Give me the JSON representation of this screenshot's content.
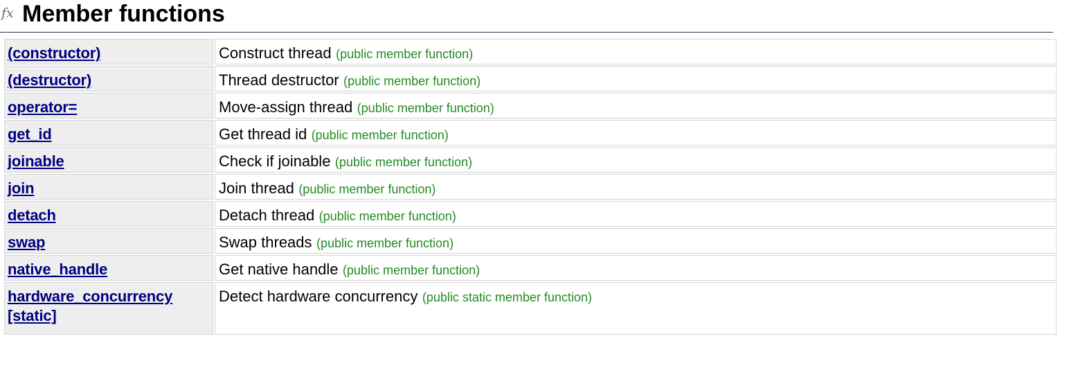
{
  "section": {
    "icon_text": "fx",
    "title": "Member functions"
  },
  "rows": [
    {
      "name": "(constructor)",
      "description": "Construct thread",
      "kind": "(public member function)"
    },
    {
      "name": "(destructor)",
      "description": "Thread destructor",
      "kind": "(public member function)"
    },
    {
      "name": "operator=",
      "description": "Move-assign thread",
      "kind": "(public member function)"
    },
    {
      "name": "get_id",
      "description": "Get thread id",
      "kind": "(public member function)"
    },
    {
      "name": "joinable",
      "description": "Check if joinable",
      "kind": "(public member function)"
    },
    {
      "name": "join",
      "description": "Join thread",
      "kind": "(public member function)"
    },
    {
      "name": "detach",
      "description": "Detach thread",
      "kind": "(public member function)"
    },
    {
      "name": "swap",
      "description": "Swap threads",
      "kind": "(public member function)"
    },
    {
      "name": "native_handle",
      "description": "Get native handle",
      "kind": "(public member function)"
    },
    {
      "name_line1": "hardware_concurrency",
      "name_line2": "[static]",
      "description": "Detect hardware concurrency",
      "kind": "(public static member function)"
    }
  ],
  "colors": {
    "link": "#000080",
    "kind": "#228b22",
    "name_cell_bg": "#eeeeee",
    "border": "#d3d3d3",
    "header_rule": "#203a54"
  }
}
